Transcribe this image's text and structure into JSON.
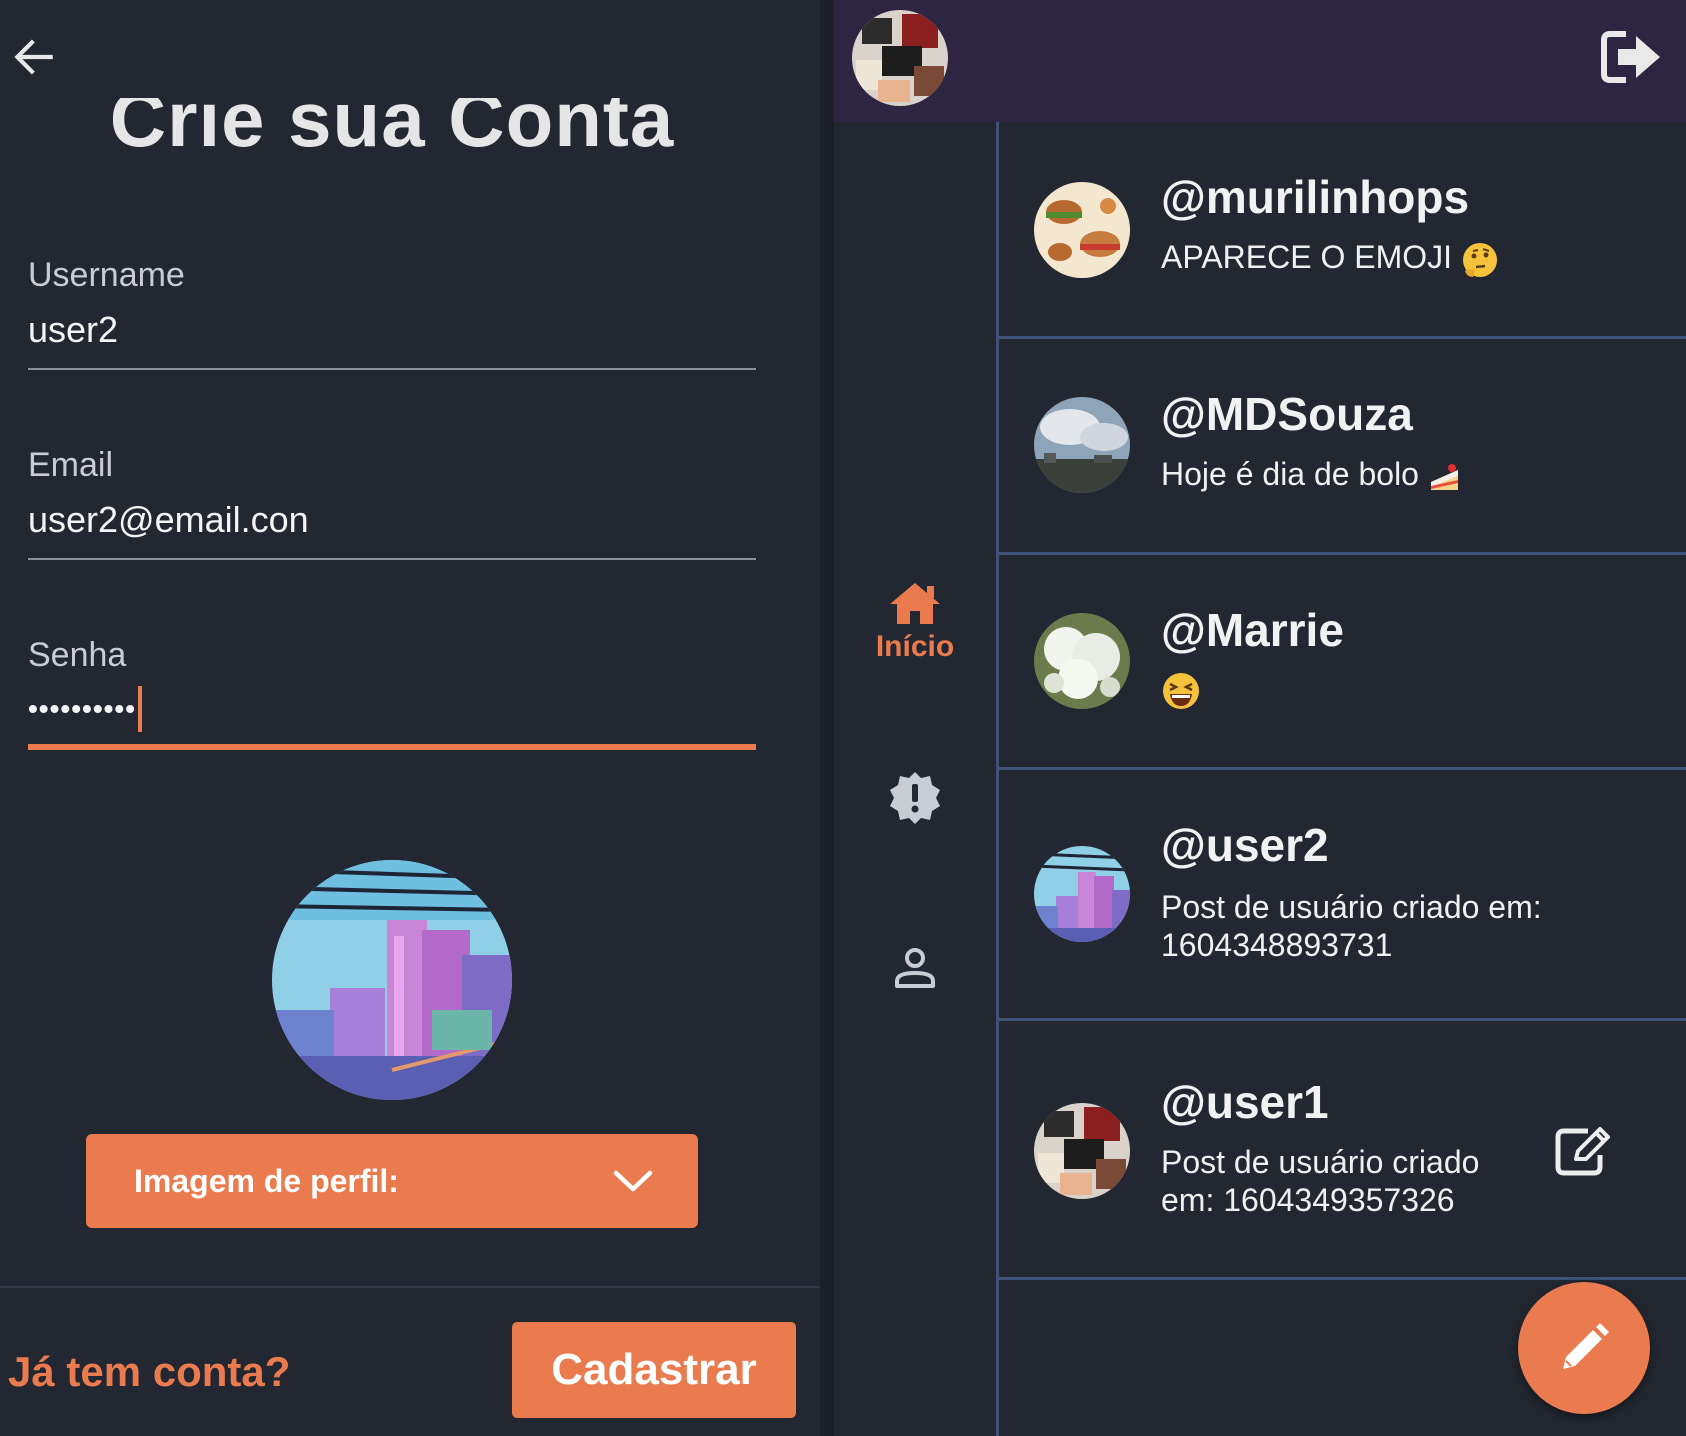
{
  "register": {
    "back_icon": "arrow-left-icon",
    "title": "Crie sua Conta",
    "username_label": "Username",
    "username_value": "user2",
    "email_label": "Email",
    "email_value": "user2@email.con",
    "password_label": "Senha",
    "password_value": "••••••••••",
    "profile_select_label": "Imagem de perfil:",
    "login_link": "Já tem conta?",
    "submit_label": "Cadastrar"
  },
  "topbar": {
    "logout_icon": "logout-icon"
  },
  "nav": {
    "home_label": "Início",
    "items": [
      "home-icon",
      "alert-badge-icon",
      "person-icon"
    ]
  },
  "posts": [
    {
      "username": "@murilinhops",
      "text": "APARECE O EMOJI",
      "emoji": "thinking-face"
    },
    {
      "username": "@MDSouza",
      "text": "Hoje é dia de bolo",
      "emoji": "cake-slice"
    },
    {
      "username": "@Marrie",
      "text": "",
      "emoji": "laughing-face"
    },
    {
      "username": "@user2",
      "text": "Post de usuário criado em: 1604348893731"
    },
    {
      "username": "@user1",
      "text": "Post de usuário criado em: 1604349357326",
      "editable": true
    }
  ],
  "colors": {
    "accent": "#ea7b4e",
    "background": "#222731",
    "topbar": "#2e2542",
    "divider": "#3f5277"
  }
}
